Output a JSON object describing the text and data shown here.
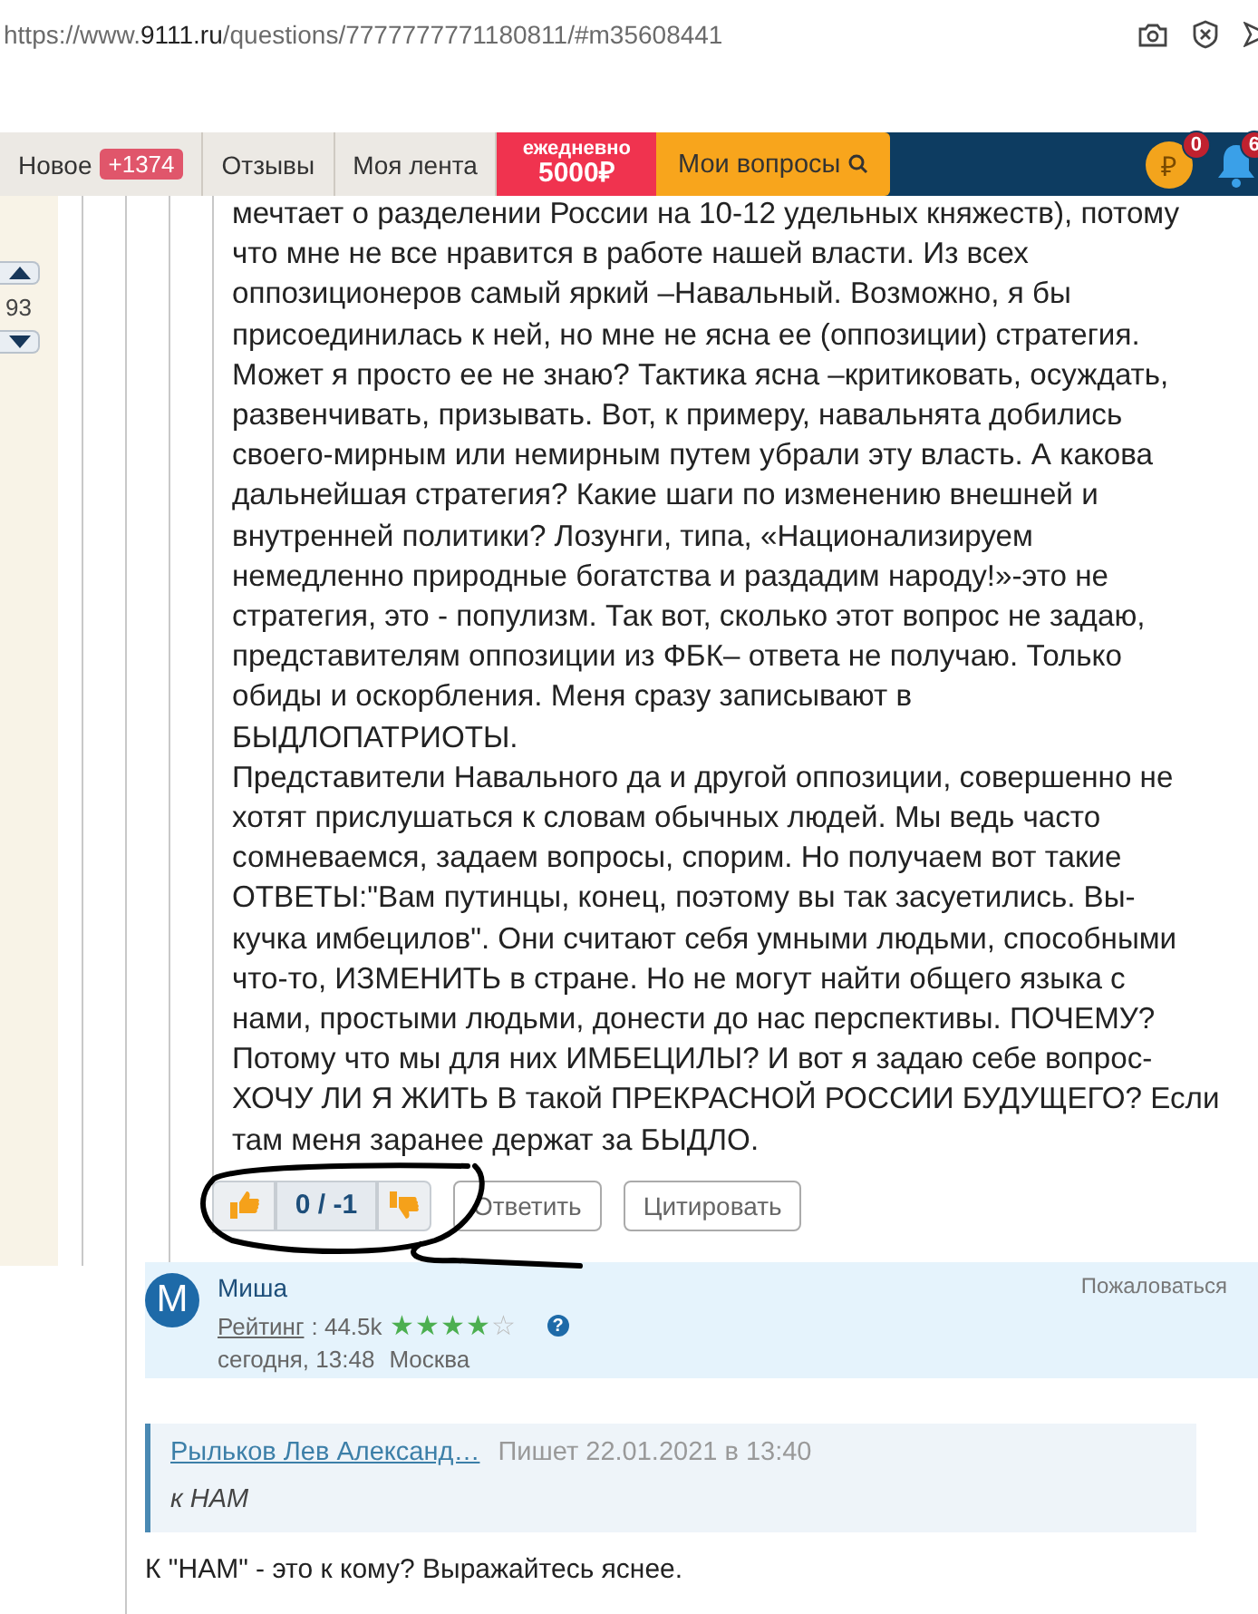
{
  "url_bar": {
    "url_scheme": "https://www.",
    "url_domain": "9111.ru",
    "url_path": "/questions/7777777771180811/#m35608441"
  },
  "nav": {
    "tabs": [
      {
        "kind": "counter",
        "label": "Новое",
        "badge": "+1374"
      },
      {
        "kind": "plain",
        "label": "Отзывы"
      },
      {
        "kind": "plain",
        "label": "Моя лента"
      },
      {
        "kind": "promo",
        "label": "ежедневно",
        "value": "5000₽"
      },
      {
        "kind": "search",
        "label": "Мои вопросы"
      }
    ],
    "coins": {
      "symbol": "₽",
      "badge": "0"
    },
    "notifications": {
      "badge": "6"
    }
  },
  "question_votes": {
    "count": "93"
  },
  "post": {
    "paragraphs": [
      "мечтает о разделении России на 10-12 удельных княжеств), потому\nчто мне не все нравится в работе нашей власти. Из всех\nоппозиционеров самый яркий –Навальный. Возможно, я бы\nприсоединилась к ней, но мне не ясна ее (оппозиции) стратегия.\nМожет я просто ее не знаю? Тактика ясна –критиковать, осуждать,\nразвенчивать, призывать. Вот, к примеру, навальнята добились\nсвоего-мирным или немирным путем убрали эту власть. А какова\nдальнейшая стратегия? Какие шаги по изменению внешней и\nвнутренней политики? Лозунги, типа, «Национализируем\nнемедленно природные богатства и раздадим народу!»-это не\nстратегия, это - популизм. Так вот, сколько этот вопрос не задаю,\nпредставителям оппозиции из ФБК– ответа не получаю. Только\nобиды и оскорбления. Меня сразу записывают в\nБЫДЛОПАТРИОТЫ.",
      "Представители Навального да и другой оппозиции, совершенно не\nхотят прислушаться к словам обычных людей. Мы ведь часто\nсомневаемся, задаем вопросы, спорим. Но получаем вот такие\nОТВЕТЫ:\"Вам путинцы, конец, поэтому вы так засуетились. Вы-\nкучка имбецилов\". Они считают себя умными людьми, способными\nчто-то, ИЗМЕНИТЬ в стране. Но не могут найти общего языка с\nнами, простыми людьми, донести до нас перспективы. ПОЧЕМУ?\nПотому что мы для них ИМБЕЦИЛЫ? И вот я задаю себе вопрос-\nХОЧУ ЛИ Я ЖИТЬ В такой ПРЕКРАСНОЙ РОССИИ БУДУЩЕГО? Если\nтам меня заранее держат за БЫДЛО."
    ],
    "rating": "0 / -1",
    "actions": [
      "Ответить",
      "Цитировать"
    ]
  },
  "comment": {
    "avatar_letter": "M",
    "author": "Миша",
    "report": "Пожаловаться",
    "rating_label": "Рейтинг",
    "rating_value": ": 44.5k",
    "stars": 4,
    "help": "?",
    "date": "сегодня, 13:48",
    "city": "Москва",
    "quote": {
      "author": "Рыльков Лев Александ…",
      "meta": "Пишет 22.01.2021 в 13:40",
      "text": "к НАМ"
    },
    "text": "К \"НАМ\" - это к кому? Выражайтесь яснее."
  }
}
